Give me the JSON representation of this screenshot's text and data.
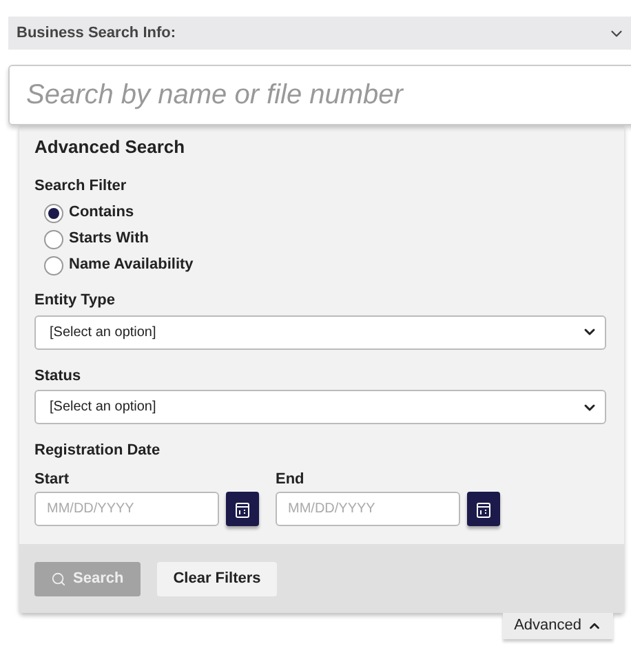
{
  "header": {
    "title": "Business Search Info:"
  },
  "search": {
    "placeholder": "Search by name or file number"
  },
  "panel": {
    "title": "Advanced Search",
    "filter_label": "Search Filter",
    "filters": [
      {
        "label": "Contains",
        "selected": true
      },
      {
        "label": "Starts With",
        "selected": false
      },
      {
        "label": "Name Availability",
        "selected": false
      }
    ],
    "selects": [
      {
        "label": "Entity Type",
        "value": "[Select an option]"
      },
      {
        "label": "Status",
        "value": "[Select an option]"
      }
    ],
    "date_label": "Registration Date",
    "dates": [
      {
        "label": "Start",
        "placeholder": "MM/DD/YYYY"
      },
      {
        "label": "End",
        "placeholder": "MM/DD/YYYY"
      }
    ],
    "buttons": [
      {
        "label": "Search",
        "disabled": true
      },
      {
        "label": "Clear Filters",
        "disabled": false
      }
    ]
  },
  "toggle": {
    "label": "Advanced",
    "expanded": true
  }
}
